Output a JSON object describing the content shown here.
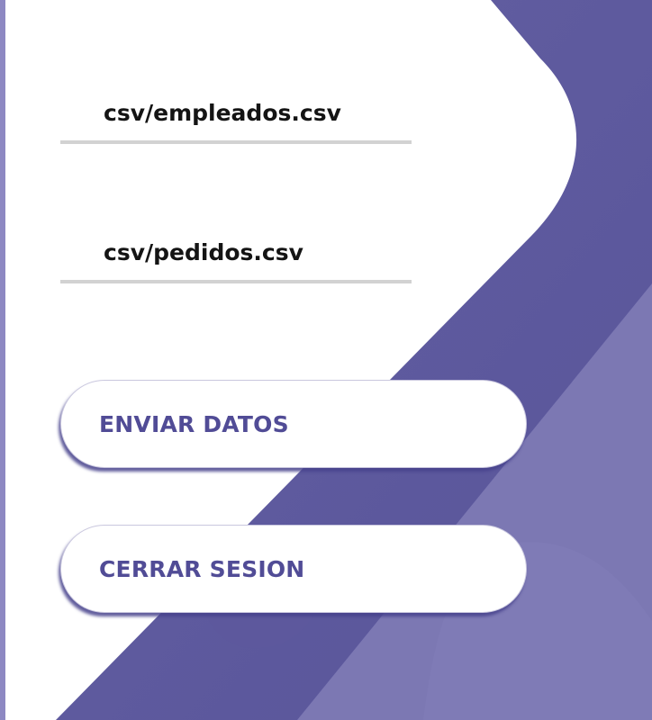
{
  "form": {
    "employees_file": {
      "value": "csv/empleados.csv"
    },
    "orders_file": {
      "value": "csv/pedidos.csv"
    }
  },
  "actions": {
    "send_label": "ENVIAR DATOS",
    "logout_label": "CERRAR SESION"
  },
  "theme": {
    "primary": "#5b569c",
    "primary_light": "#7d79b3",
    "button_text": "#514c96",
    "underline": "#d2d2d2",
    "input_text": "#141414"
  }
}
